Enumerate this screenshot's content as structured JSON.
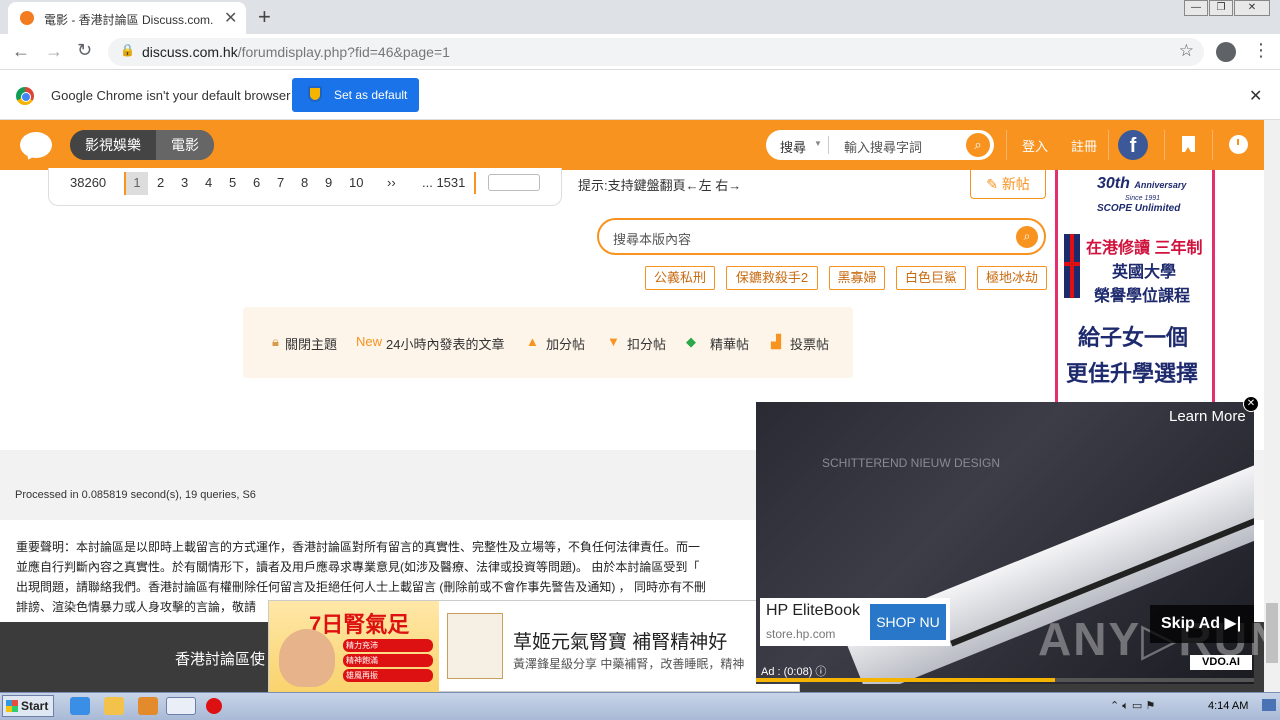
{
  "browser": {
    "tab_title": "電影 - 香港討論區 Discuss.com.hk - ",
    "url_host": "discuss.com.hk",
    "url_path": "/forumdisplay.php?fid=46&page=1",
    "infobar_text": "Google Chrome isn't your default browser",
    "set_default_label": "Set as default"
  },
  "site": {
    "nav_primary": "影視娛樂",
    "nav_secondary": "電影",
    "search_type": "搜尋",
    "search_placeholder": "輸入搜尋字詞",
    "login": "登入",
    "register": "註冊",
    "fb_letter": "f"
  },
  "pager": {
    "total": "38260",
    "current": "1",
    "pages": [
      "2",
      "3",
      "4",
      "5",
      "6",
      "7",
      "8",
      "9",
      "10"
    ],
    "next": "››",
    "last": "... 1531"
  },
  "hint": "提示:支持鍵盤翻頁←左 右→",
  "new_post": "新帖",
  "board_search_placeholder": "搜尋本版內容",
  "tags": [
    "公義私刑",
    "保鑣救殺手2",
    "黑寡婦",
    "白色巨鯊",
    "極地冰劫"
  ],
  "legend": {
    "closed": "關閉主題",
    "new_badge": "New",
    "new_text": "24小時內發表的文章",
    "plus": "加分帖",
    "minus": "扣分帖",
    "digest": "精華帖",
    "poll": "投票帖"
  },
  "processed": "Processed in 0.085819 second(s), 19 queries, S6",
  "disclaimer": [
    "重要聲明：本討論區是以即時上載留言的方式運作，香港討論區對所有留言的真實性、完整性及立場等，不負任何法律責任。而一",
    "並應自行判斷內容之真實性。於有關情形下，讀者及用戶應尋求專業意見(如涉及醫療、法律或投資等問題)。 由於本討論區受到「",
    "出現問題，請聯絡我們。香港討論區有權刪除任何留言及拒絕任何人士上載留言 (刪除前或不會作事先警告及通知) ， 同時亦有不刪",
    "誹謗、渲染色情暴力或人身攻擊的言論，敬請"
  ],
  "footer_link": "香港討論區使",
  "side_ad": {
    "line1": "30th",
    "line1b": "Anniversary",
    "line1c": "Since 1991",
    "line1d": "SCOPE Unlimited",
    "red1": "在港修讀 三年制",
    "blue1": "英國大學",
    "blue2": "榮譽學位課程",
    "big1": "給子女一個",
    "big2": "更佳升學選擇"
  },
  "bottom_ad": {
    "badge": "7日腎氣足",
    "bullets": [
      "精力充沛",
      "精神飽滿",
      "雄風再振"
    ],
    "headline": "草姬元氣腎寶 補腎精神好",
    "sub": "黃澤鋒星級分享 中藥補腎，改善睡眠，精神"
  },
  "video_ad": {
    "learn_more": "Learn More",
    "overlay_text": "SCHITTEREND NIEUW DESIGN",
    "product": "HP EliteBook",
    "domain": "store.hp.com",
    "shop": "SHOP NU",
    "skip": "Skip Ad ▶|",
    "vdo": "VDO.AI",
    "time": "Ad : (0:08)",
    "progress": 0.6
  },
  "watermark": "ANY▷RUN",
  "taskbar": {
    "start": "Start",
    "time": "4:14 AM"
  },
  "colors": {
    "accent": "#f7931e",
    "chrome_blue": "#1a73e8",
    "facebook": "#3b5998"
  }
}
